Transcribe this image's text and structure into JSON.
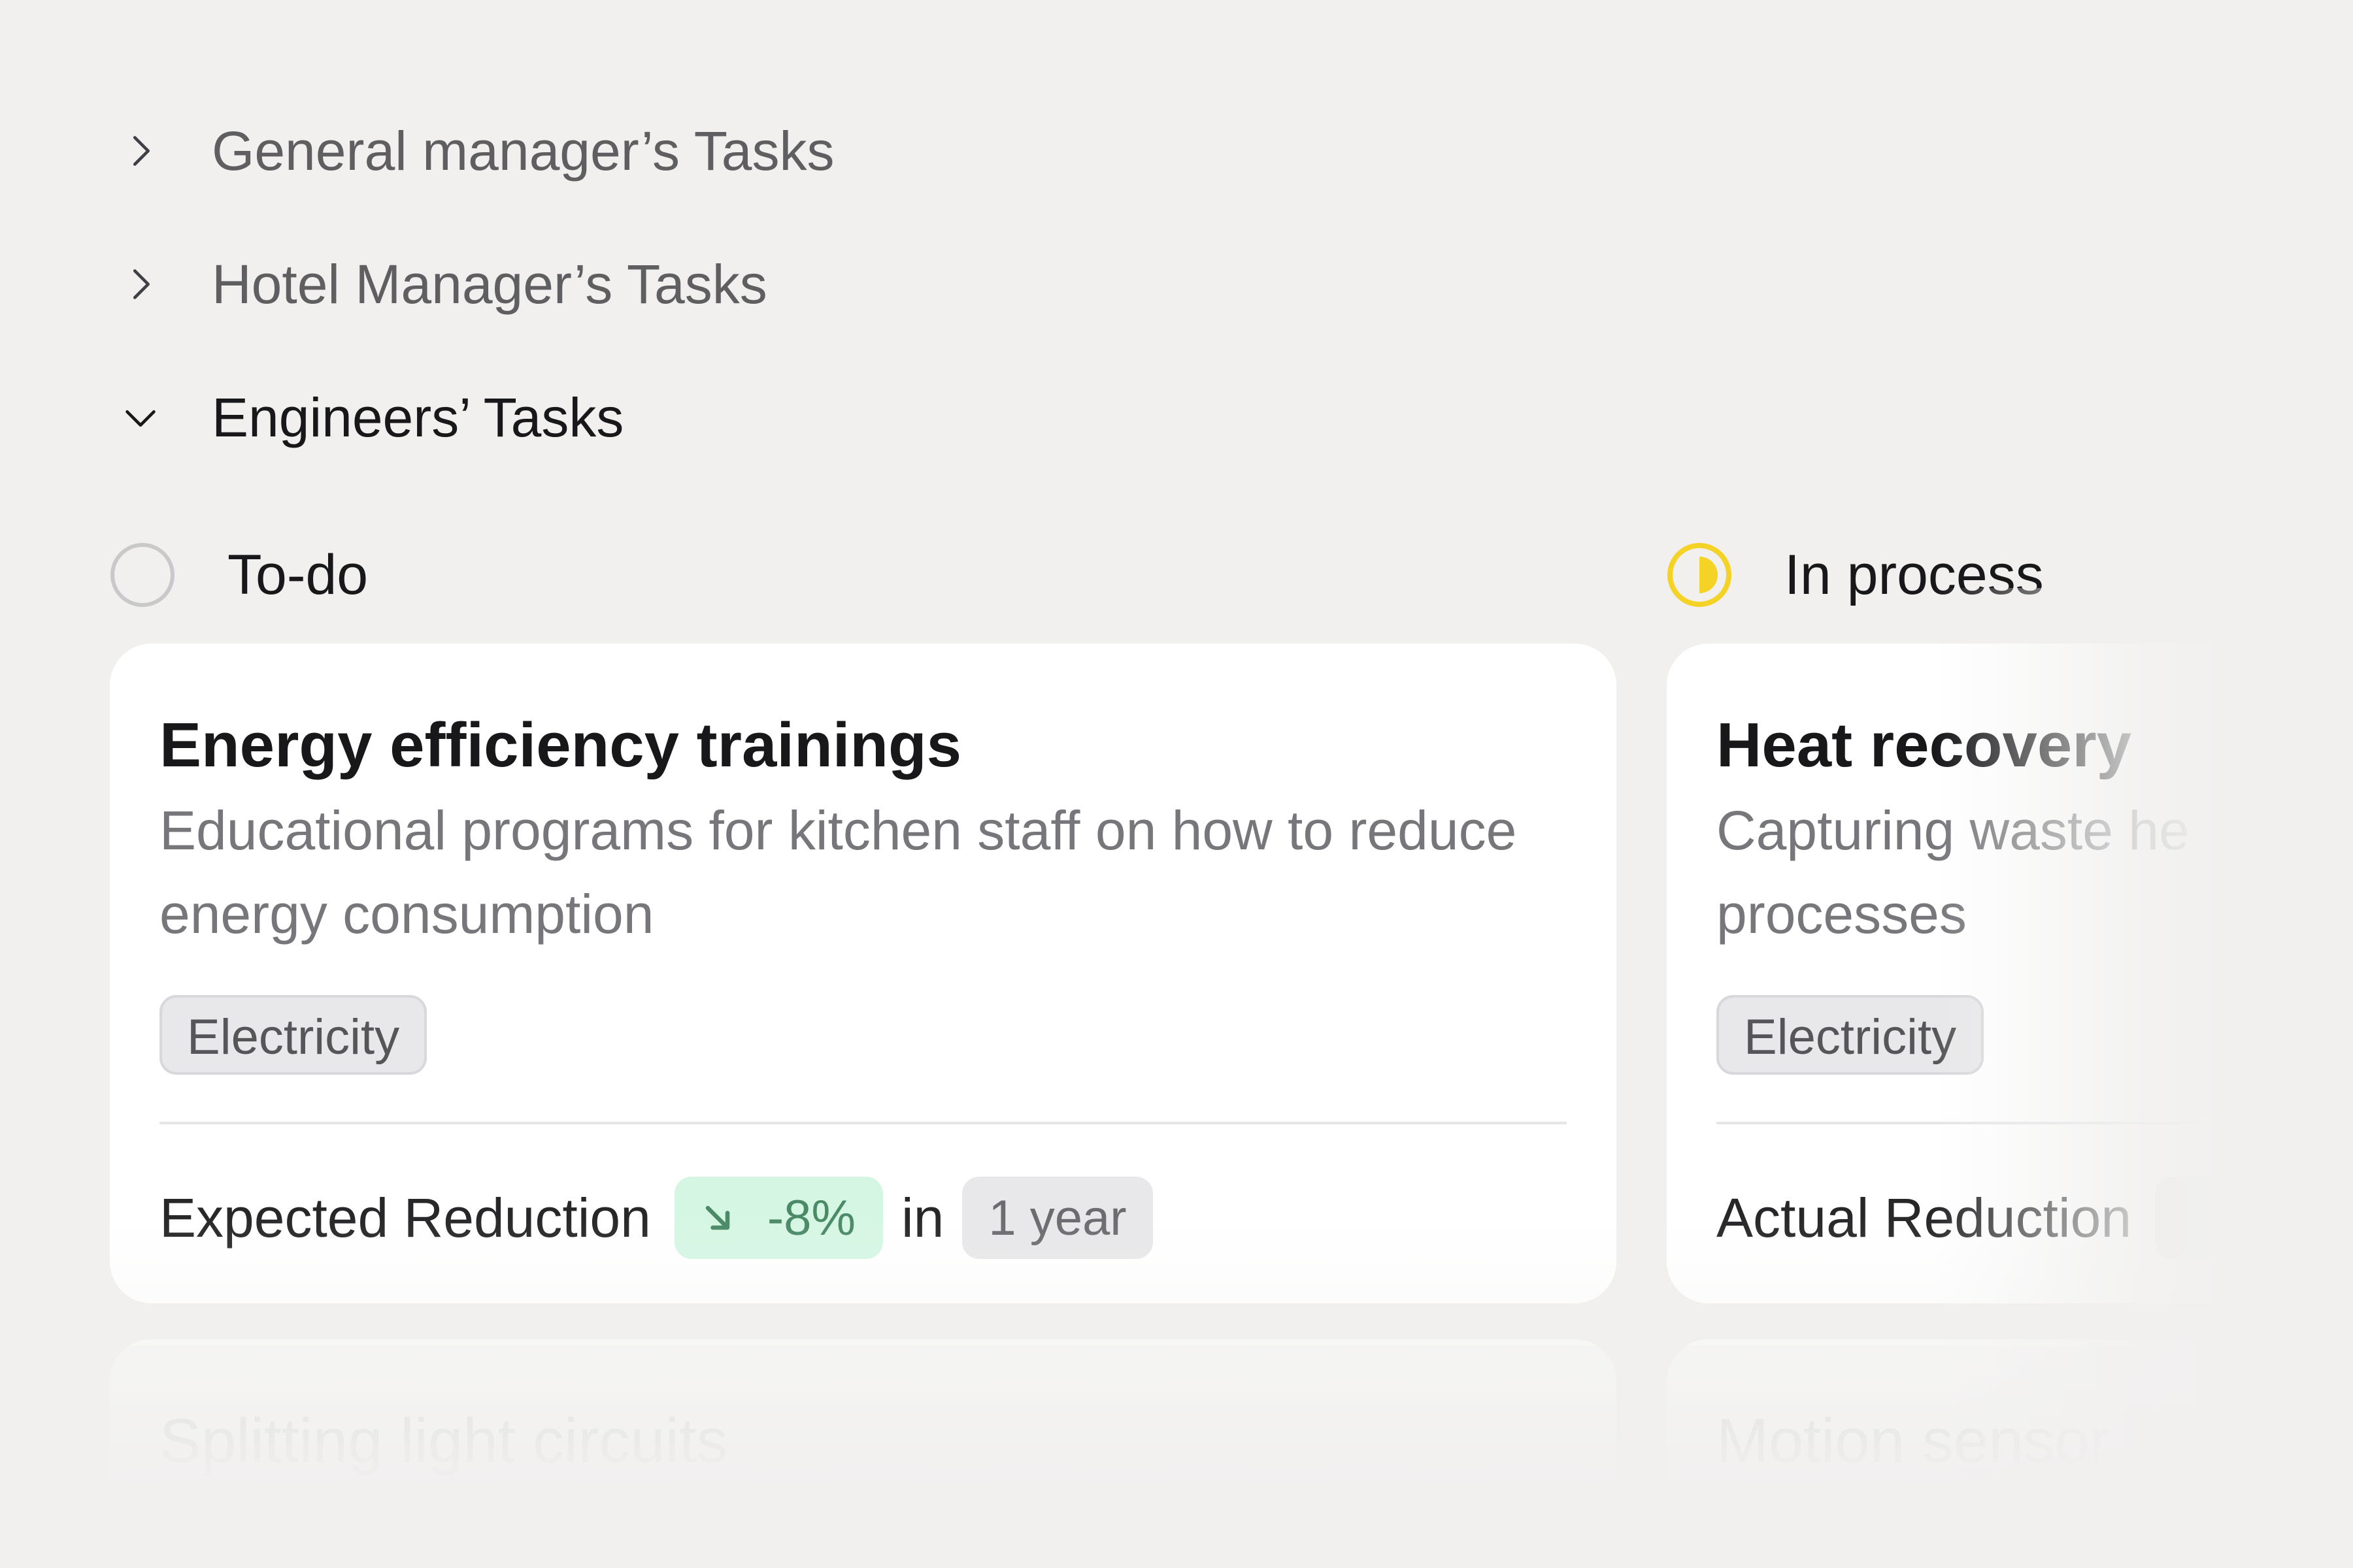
{
  "sections": [
    {
      "title": "General manager’s Tasks",
      "expanded": false,
      "icon": "chevron-right-icon"
    },
    {
      "title": "Hotel Manager’s Tasks",
      "expanded": false,
      "icon": "chevron-right-icon"
    },
    {
      "title": "Engineers’ Tasks",
      "expanded": true,
      "icon": "chevron-down-icon"
    }
  ],
  "columns": [
    {
      "title": "To-do",
      "status_icon": "empty-circle-icon",
      "status_color": "#c9c9cc",
      "cards": [
        {
          "title": "Energy efficiency trainings",
          "description": "Educational programs for kitchen staff on how to reduce energy consumption",
          "tag": "Electricity",
          "reduction_label": "Expected Reduction",
          "reduction_value": "-8%",
          "reduction_icon": "arrow-down-right-icon",
          "in_word": "in",
          "period": "1 year"
        },
        {
          "title": "Splitting light circuits"
        }
      ]
    },
    {
      "title": "In process",
      "status_icon": "half-circle-icon",
      "status_color": "#f5d226",
      "cards": [
        {
          "title": "Heat recovery",
          "description": "Capturing waste he processes",
          "tag": "Electricity",
          "reduction_label": "Actual Reduction"
        },
        {
          "title": "Motion sensor"
        }
      ]
    }
  ]
}
